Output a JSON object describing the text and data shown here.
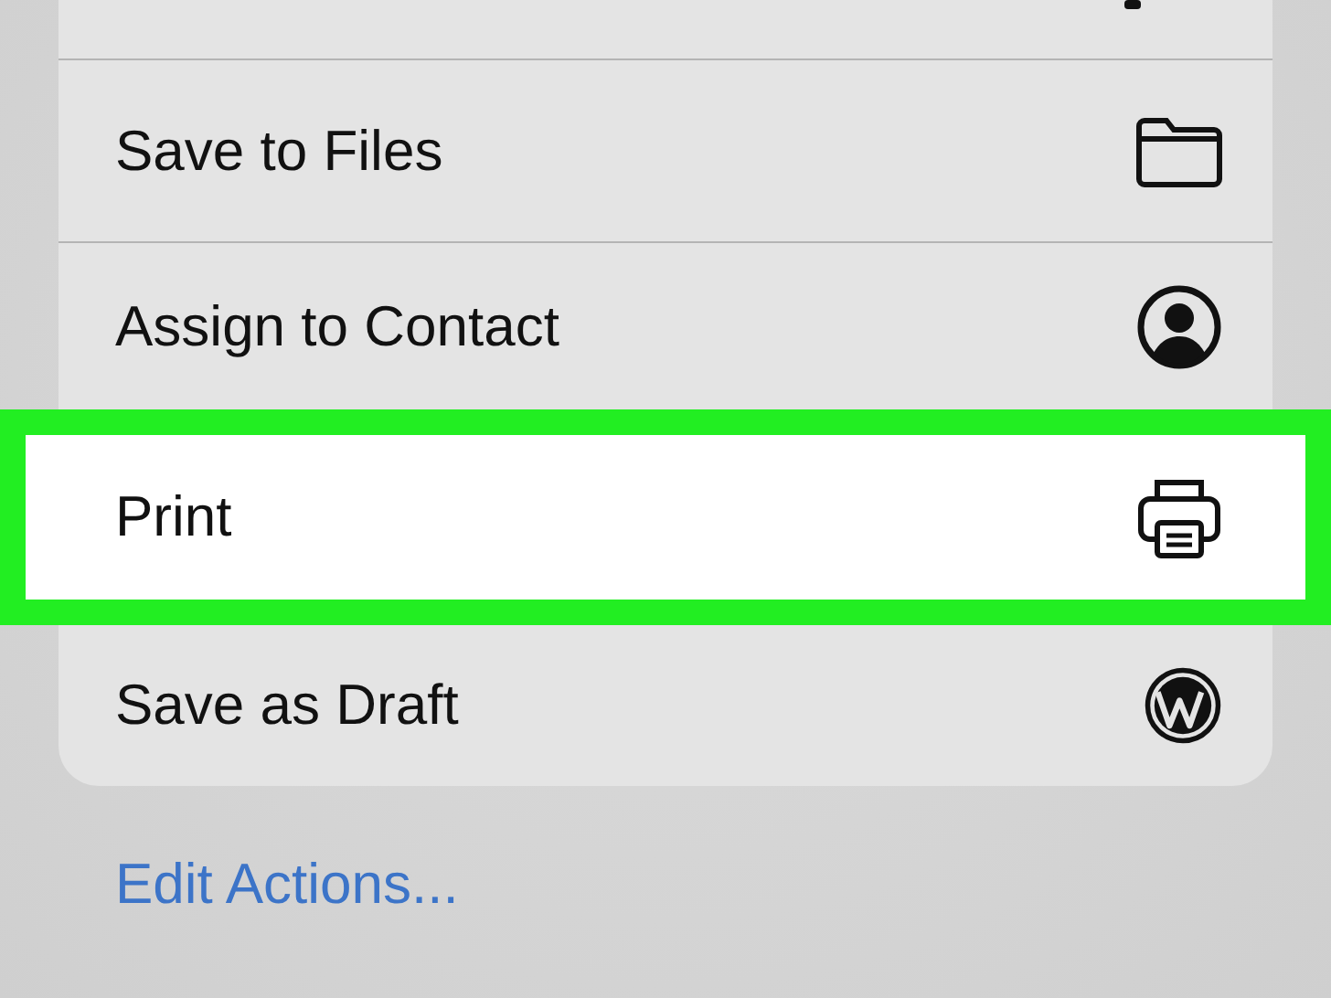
{
  "actions": [
    {
      "kind": "partial"
    },
    {
      "kind": "folder",
      "label": "Save to Files",
      "highlighted": false
    },
    {
      "kind": "contact",
      "label": "Assign to Contact",
      "highlighted": false
    },
    {
      "kind": "printer",
      "label": "Print",
      "highlighted": true
    },
    {
      "kind": "wordpress",
      "label": "Save as Draft",
      "highlighted": false
    }
  ],
  "edit_link": "Edit Actions..."
}
